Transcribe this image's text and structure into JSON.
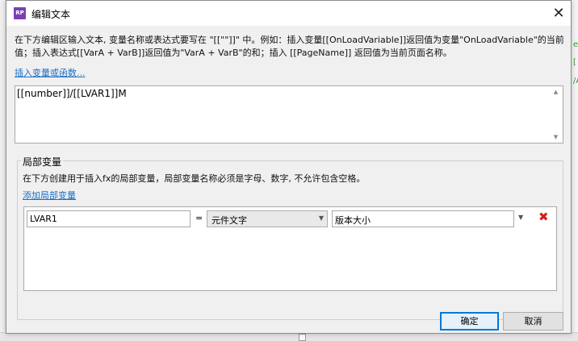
{
  "dialog": {
    "title": "编辑文本",
    "app_icon": "RP",
    "description": "在下方编辑区输入文本, 变量名称或表达式要写在 \"[[\"\"]]\" 中。例如：插入变量[[OnLoadVariable]]返回值为变量\"OnLoadVariable\"的当前值；插入表达式[[VarA + VarB]]返回值为\"VarA + VarB\"的和；插入 [[PageName]] 返回值为当前页面名称。",
    "insert_link": "插入变量或函数...",
    "editor_text": "[[number]]/[[LVAR1]]M"
  },
  "local_vars": {
    "legend": "局部变量",
    "description": "在下方创建用于插入fx的局部变量，局部变量名称必须是字母、数字, 不允许包含空格。",
    "add_link": "添加局部变量",
    "rows": [
      {
        "name": "LVAR1",
        "equals": "=",
        "type": "元件文字",
        "value": "版本大小"
      }
    ]
  },
  "buttons": {
    "ok": "确定",
    "cancel": "取消"
  },
  "background": {
    "right_glyph_1": "e",
    "right_glyph_2": "[",
    "right_glyph_3": "/A"
  },
  "colors": {
    "link": "#1a6fc4",
    "delete": "#d21f1f",
    "app_icon": "#7a3fb5"
  }
}
